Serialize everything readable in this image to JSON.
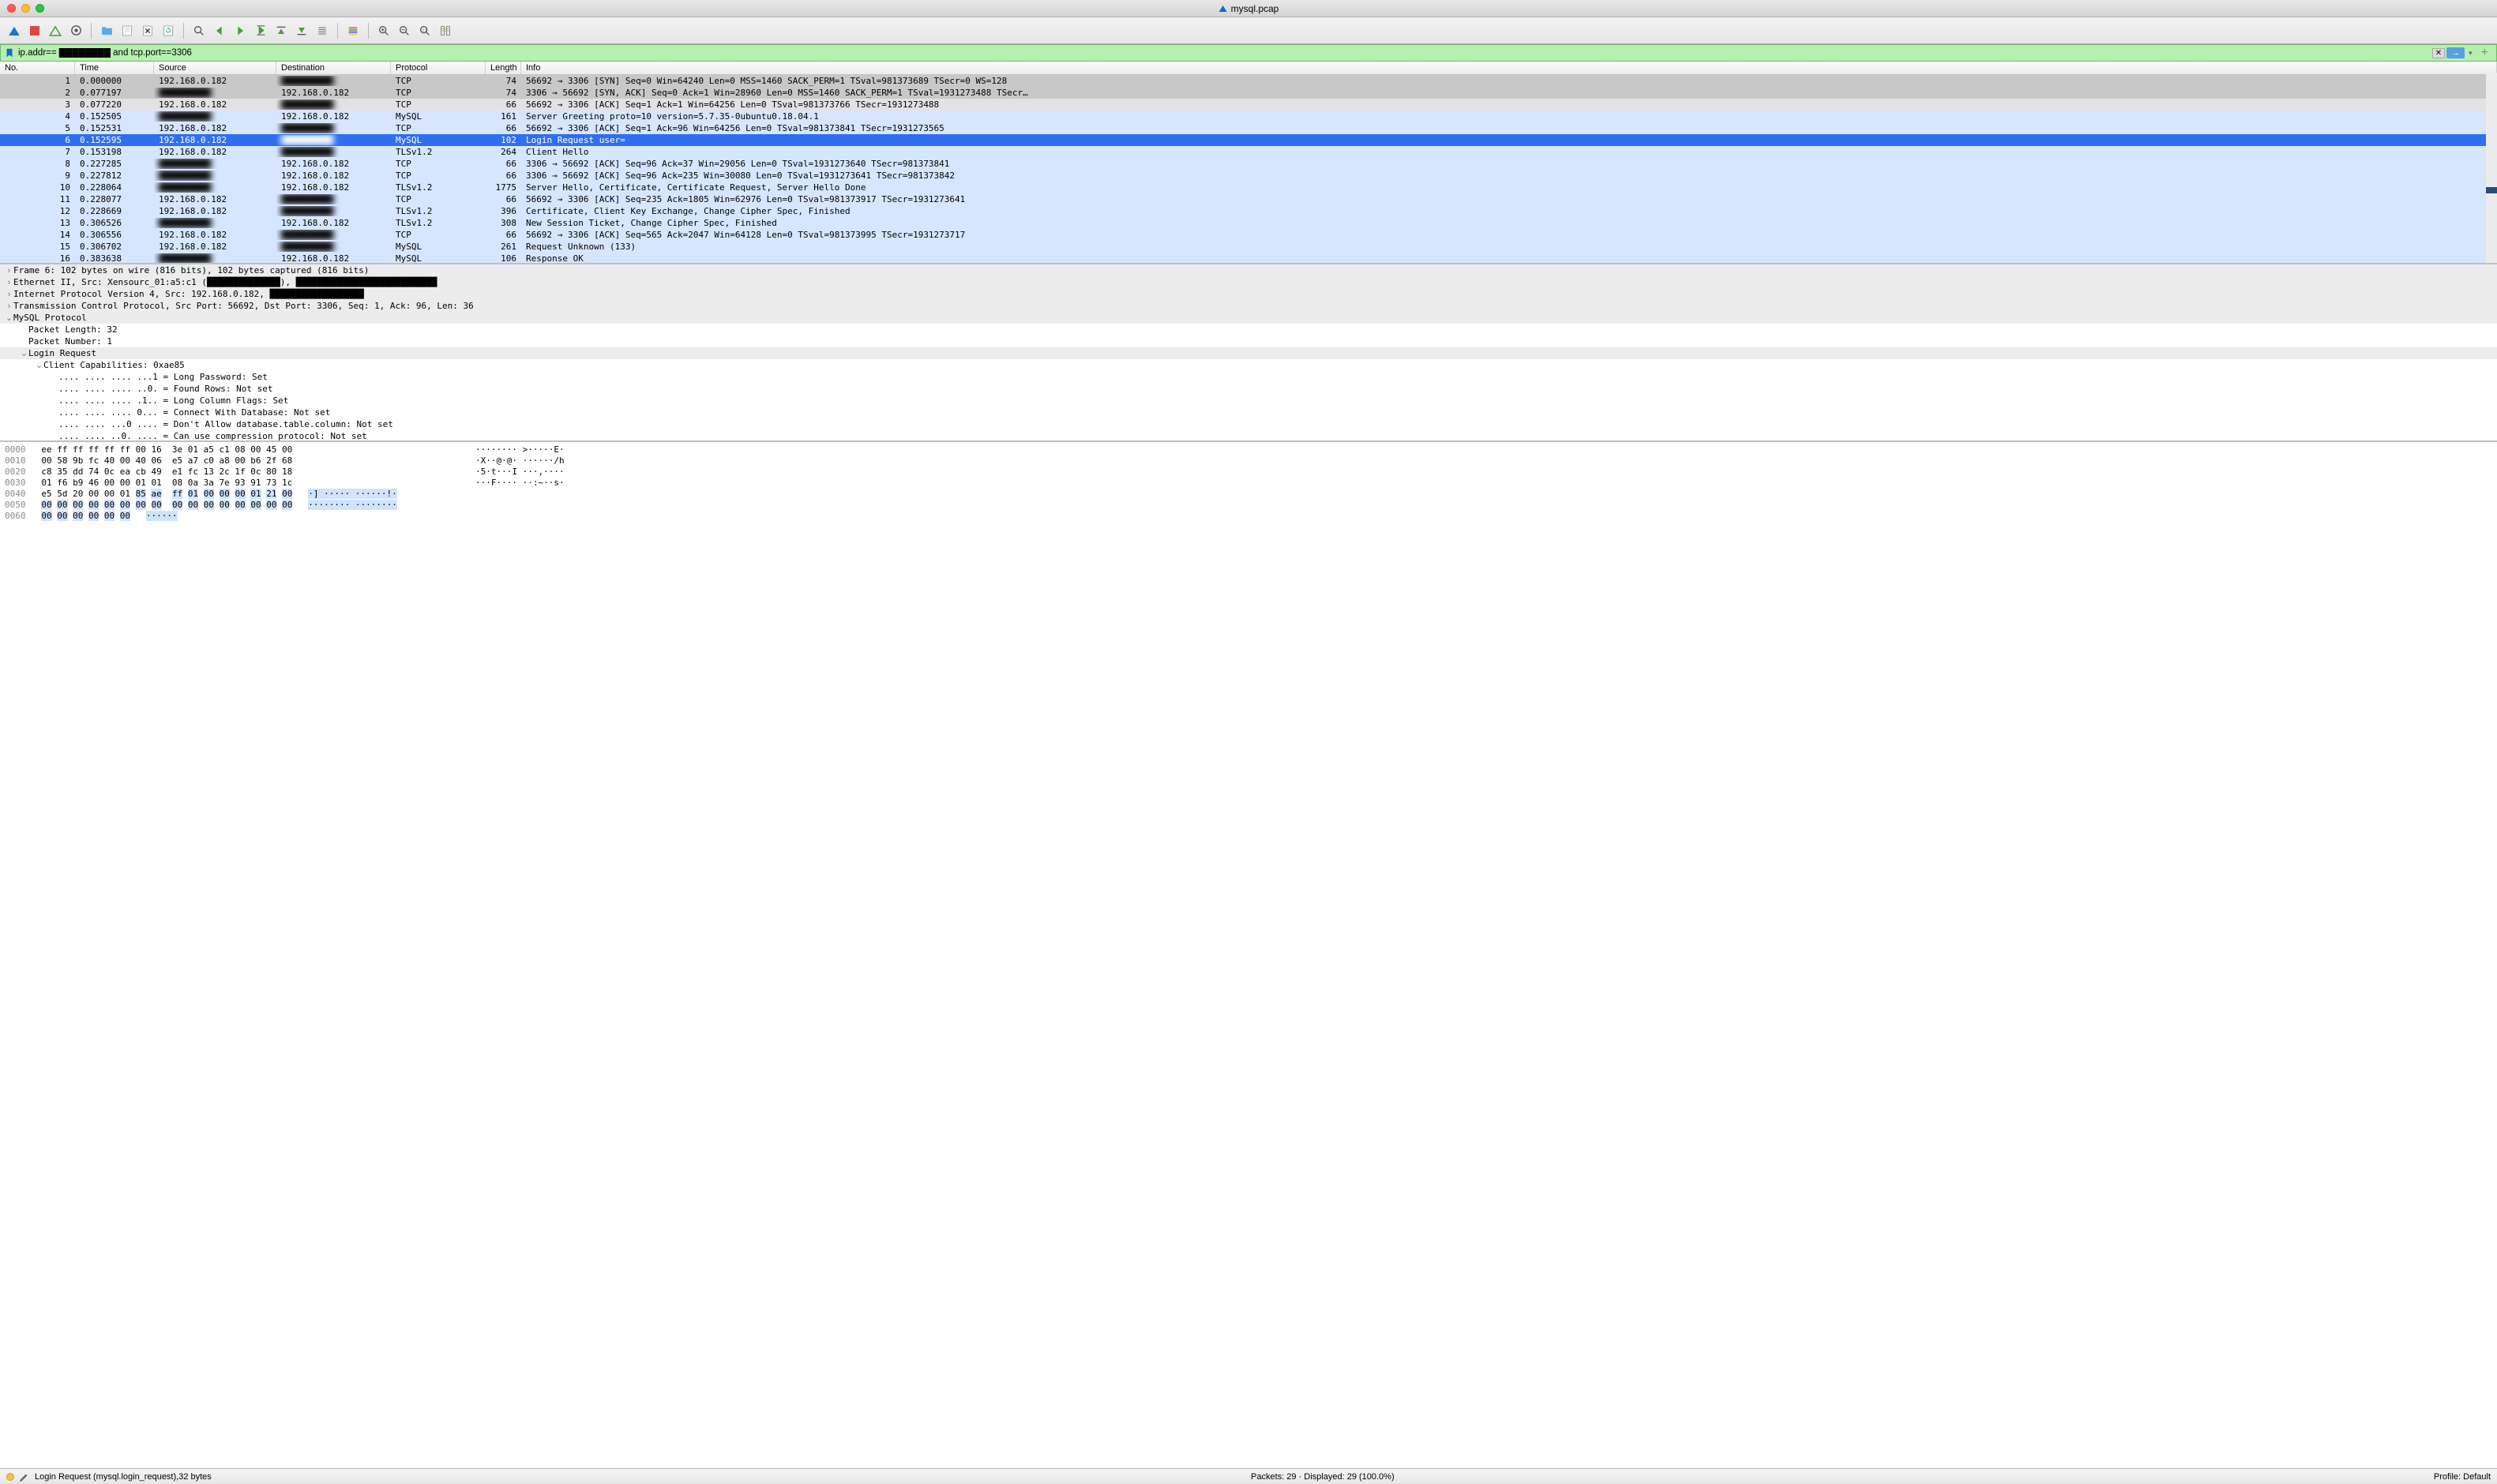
{
  "title": "mysql.pcap",
  "filter": "ip.addr== ████████ and tcp.port==3306",
  "columns": {
    "no": "No.",
    "time": "Time",
    "src": "Source",
    "dst": "Destination",
    "proto": "Protocol",
    "len": "Length",
    "info": "Info"
  },
  "packets": [
    {
      "no": 1,
      "time": "0.000000",
      "src": "192.168.0.182",
      "dst": "██████████",
      "proto": "TCP",
      "len": 74,
      "info": "56692 → 3306 [SYN] Seq=0 Win=64240 Len=0 MSS=1460 SACK_PERM=1 TSval=981373689 TSecr=0 WS=128",
      "cls": "gray",
      "srcblur": false,
      "dstblur": true
    },
    {
      "no": 2,
      "time": "0.077197",
      "src": "██████████",
      "dst": "192.168.0.182",
      "proto": "TCP",
      "len": 74,
      "info": "3306 → 56692 [SYN, ACK] Seq=0 Ack=1 Win=28960 Len=0 MSS=1460 SACK_PERM=1 TSval=1931273488 TSecr…",
      "cls": "gray",
      "srcblur": true,
      "dstblur": false
    },
    {
      "no": 3,
      "time": "0.077220",
      "src": "192.168.0.182",
      "dst": "██████████",
      "proto": "TCP",
      "len": 66,
      "info": "56692 → 3306 [ACK] Seq=1 Ack=1 Win=64256 Len=0 TSval=981373766 TSecr=1931273488",
      "cls": "lightgray",
      "srcblur": false,
      "dstblur": true
    },
    {
      "no": 4,
      "time": "0.152505",
      "src": "██████████",
      "dst": "192.168.0.182",
      "proto": "MySQL",
      "len": 161,
      "info": "Server Greeting proto=10 version=5.7.35-0ubuntu0.18.04.1",
      "cls": "related",
      "srcblur": true,
      "dstblur": false
    },
    {
      "no": 5,
      "time": "0.152531",
      "src": "192.168.0.182",
      "dst": "██████████",
      "proto": "TCP",
      "len": 66,
      "info": "56692 → 3306 [ACK] Seq=1 Ack=96 Win=64256 Len=0 TSval=981373841 TSecr=1931273565",
      "cls": "related",
      "srcblur": false,
      "dstblur": true
    },
    {
      "no": 6,
      "time": "0.152595",
      "src": "192.168.0.182",
      "dst": "██████████",
      "proto": "MySQL",
      "len": 102,
      "info": "Login Request user=",
      "cls": "sel",
      "srcblur": false,
      "dstblur": true
    },
    {
      "no": 7,
      "time": "0.153198",
      "src": "192.168.0.182",
      "dst": "██████████",
      "proto": "TLSv1.2",
      "len": 264,
      "info": "Client Hello",
      "cls": "related",
      "srcblur": false,
      "dstblur": true
    },
    {
      "no": 8,
      "time": "0.227285",
      "src": "██████████",
      "dst": "192.168.0.182",
      "proto": "TCP",
      "len": 66,
      "info": "3306 → 56692 [ACK] Seq=96 Ack=37 Win=29056 Len=0 TSval=1931273640 TSecr=981373841",
      "cls": "related",
      "srcblur": true,
      "dstblur": false
    },
    {
      "no": 9,
      "time": "0.227812",
      "src": "██████████",
      "dst": "192.168.0.182",
      "proto": "TCP",
      "len": 66,
      "info": "3306 → 56692 [ACK] Seq=96 Ack=235 Win=30080 Len=0 TSval=1931273641 TSecr=981373842",
      "cls": "related",
      "srcblur": true,
      "dstblur": false
    },
    {
      "no": 10,
      "time": "0.228064",
      "src": "██████████",
      "dst": "192.168.0.182",
      "proto": "TLSv1.2",
      "len": 1775,
      "info": "Server Hello, Certificate, Certificate Request, Server Hello Done",
      "cls": "related",
      "srcblur": true,
      "dstblur": false
    },
    {
      "no": 11,
      "time": "0.228077",
      "src": "192.168.0.182",
      "dst": "██████████",
      "proto": "TCP",
      "len": 66,
      "info": "56692 → 3306 [ACK] Seq=235 Ack=1805 Win=62976 Len=0 TSval=981373917 TSecr=1931273641",
      "cls": "related",
      "srcblur": false,
      "dstblur": true
    },
    {
      "no": 12,
      "time": "0.228669",
      "src": "192.168.0.182",
      "dst": "██████████",
      "proto": "TLSv1.2",
      "len": 396,
      "info": "Certificate, Client Key Exchange, Change Cipher Spec, Finished",
      "cls": "related",
      "srcblur": false,
      "dstblur": true
    },
    {
      "no": 13,
      "time": "0.306526",
      "src": "██████████",
      "dst": "192.168.0.182",
      "proto": "TLSv1.2",
      "len": 308,
      "info": "New Session Ticket, Change Cipher Spec, Finished",
      "cls": "related",
      "srcblur": true,
      "dstblur": false
    },
    {
      "no": 14,
      "time": "0.306556",
      "src": "192.168.0.182",
      "dst": "██████████",
      "proto": "TCP",
      "len": 66,
      "info": "56692 → 3306 [ACK] Seq=565 Ack=2047 Win=64128 Len=0 TSval=981373995 TSecr=1931273717",
      "cls": "related",
      "srcblur": false,
      "dstblur": true
    },
    {
      "no": 15,
      "time": "0.306702",
      "src": "192.168.0.182",
      "dst": "██████████",
      "proto": "MySQL",
      "len": 261,
      "info": "Request Unknown (133)",
      "cls": "related",
      "srcblur": false,
      "dstblur": true
    },
    {
      "no": 16,
      "time": "0.383638",
      "src": "██████████",
      "dst": "192.168.0.182",
      "proto": "MySQL",
      "len": 106,
      "info": "Response OK",
      "cls": "related",
      "srcblur": true,
      "dstblur": false
    }
  ],
  "details": [
    {
      "lvl": 0,
      "tw": "›",
      "txt": "Frame 6: 102 bytes on wire (816 bits), 102 bytes captured (816 bits)",
      "hdr": true
    },
    {
      "lvl": 0,
      "tw": "›",
      "txt": "Ethernet II, Src: Xensourc_01:a5:c1 (██████████████), ███████████████████████████",
      "hdr": true,
      "blur": false
    },
    {
      "lvl": 0,
      "tw": "›",
      "txt": "Internet Protocol Version 4, Src: 192.168.0.182, ██████████████████",
      "hdr": true
    },
    {
      "lvl": 0,
      "tw": "›",
      "txt": "Transmission Control Protocol, Src Port: 56692, Dst Port: 3306, Seq: 1, Ack: 96, Len: 36",
      "hdr": true
    },
    {
      "lvl": 0,
      "tw": "⌄",
      "txt": "MySQL Protocol",
      "hdr": true
    },
    {
      "lvl": 1,
      "tw": "",
      "txt": "Packet Length: 32"
    },
    {
      "lvl": 1,
      "tw": "",
      "txt": "Packet Number: 1"
    },
    {
      "lvl": 1,
      "tw": "⌄",
      "txt": "Login Request",
      "hdr": true
    },
    {
      "lvl": 2,
      "tw": "⌄",
      "txt": "Client Capabilities: 0xae85"
    },
    {
      "lvl": 3,
      "tw": "",
      "txt": ".... .... .... ...1 = Long Password: Set"
    },
    {
      "lvl": 3,
      "tw": "",
      "txt": ".... .... .... ..0. = Found Rows: Not set"
    },
    {
      "lvl": 3,
      "tw": "",
      "txt": ".... .... .... .1.. = Long Column Flags: Set"
    },
    {
      "lvl": 3,
      "tw": "",
      "txt": ".... .... .... 0... = Connect With Database: Not set"
    },
    {
      "lvl": 3,
      "tw": "",
      "txt": ".... .... ...0 .... = Don't Allow database.table.column: Not set"
    },
    {
      "lvl": 3,
      "tw": "",
      "txt": ".... .... ..0. .... = Can use compression protocol: Not set"
    }
  ],
  "hex": [
    {
      "off": "0000",
      "b": "ee ff ff ff ff ff 00 16  3e 01 a5 c1 08 00 45 00",
      "a": "········ >·····E·",
      "sel": []
    },
    {
      "off": "0010",
      "b": "00 58 9b fc 40 00 40 06  e5 a7 c0 a8 00 b6 2f 68",
      "a": "·X··@·@· ······/h",
      "sel": []
    },
    {
      "off": "0020",
      "b": "c8 35 dd 74 0c ea cb 49  e1 fc 13 2c 1f 0c 80 18",
      "a": "·5·t···I ···,····",
      "sel": []
    },
    {
      "off": "0030",
      "b": "01 f6 b9 46 00 00 01 01  08 0a 3a 7e 93 91 73 1c",
      "a": "···F···· ··:~··s·",
      "sel": []
    },
    {
      "off": "0040",
      "b": "e5 5d 20 00 00 01 85 ae  ff 01 00 00 00 01 21 00",
      "a": "·] ····· ······!·",
      "sel": [
        6,
        16
      ]
    },
    {
      "off": "0050",
      "b": "00 00 00 00 00 00 00 00  00 00 00 00 00 00 00 00",
      "a": "········ ········",
      "sel": [
        0,
        16
      ]
    },
    {
      "off": "0060",
      "b": "00 00 00 00 00 00",
      "a": "······",
      "sel": [
        0,
        6
      ]
    }
  ],
  "status": {
    "left": "Login Request (mysql.login_request),32 bytes",
    "packets": "Packets: 29 · Displayed: 29 (100.0%)",
    "profile": "Profile: Default"
  }
}
